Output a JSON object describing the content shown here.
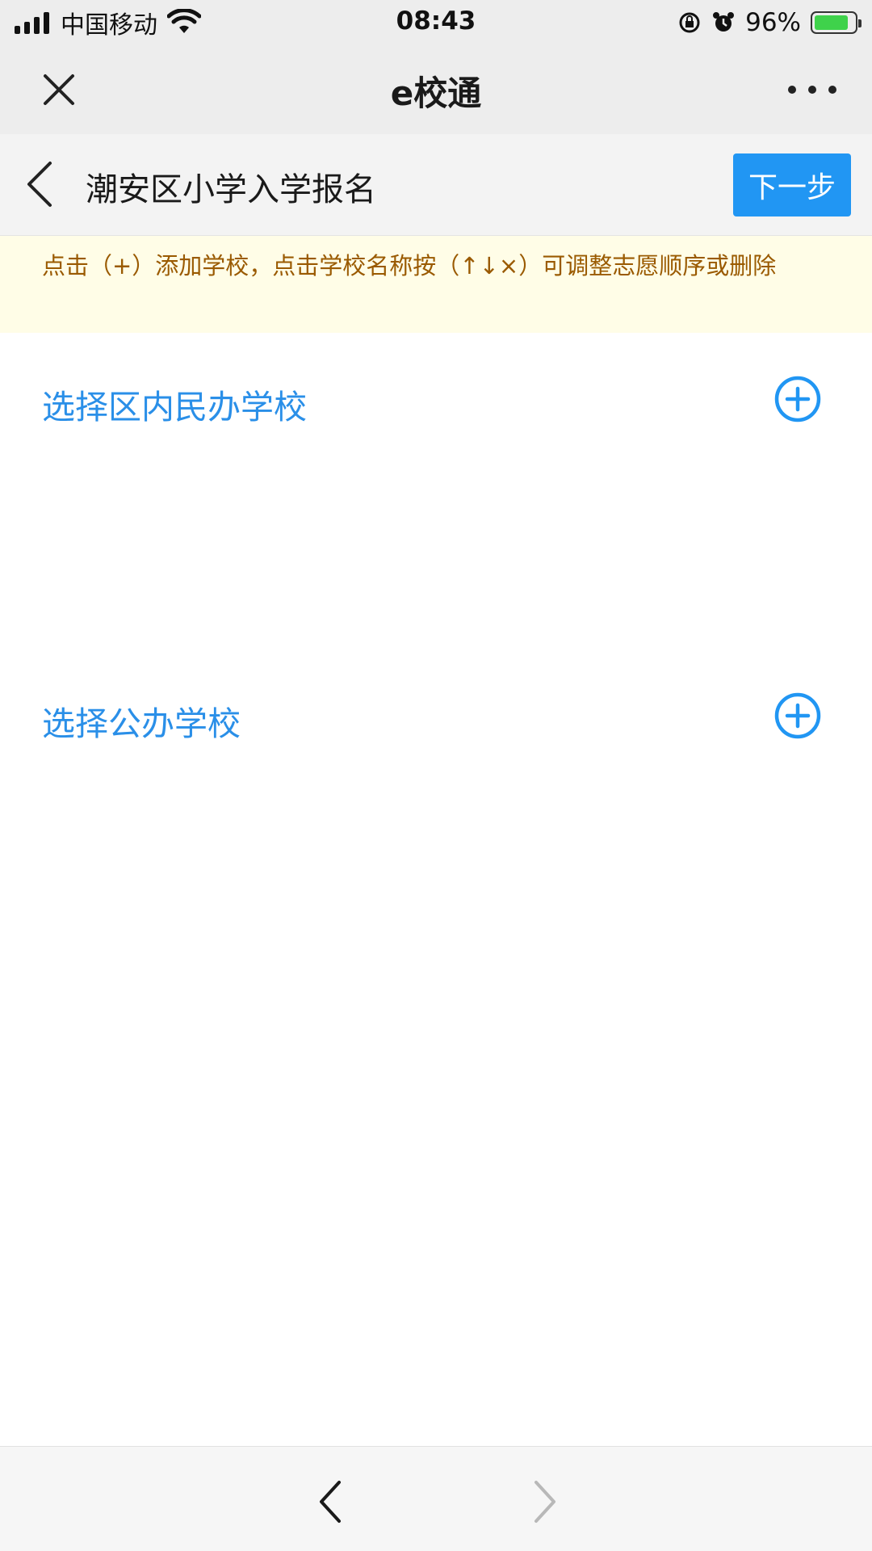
{
  "status_bar": {
    "carrier": "中国移动",
    "time": "08:43",
    "battery": "96%"
  },
  "title_bar": {
    "title": "e校通"
  },
  "page_header": {
    "title": "潮安区小学入学报名",
    "next_label": "下一步"
  },
  "notice": {
    "text": "点击（+）添加学校，点击学校名称按（↑↓×）可调整志愿顺序或删除"
  },
  "sections": [
    {
      "label": "选择区内民办学校"
    },
    {
      "label": "选择公办学校"
    }
  ],
  "colors": {
    "accent": "#2196f3",
    "link": "#2a8fe8",
    "notice_bg": "#fffde7",
    "notice_text": "#9a5a00"
  },
  "icons": {
    "close": "close-icon",
    "more": "more-icon",
    "back": "chevron-left-icon",
    "add": "plus-circle-icon",
    "nav_back": "chevron-left-icon",
    "nav_forward": "chevron-right-icon"
  }
}
